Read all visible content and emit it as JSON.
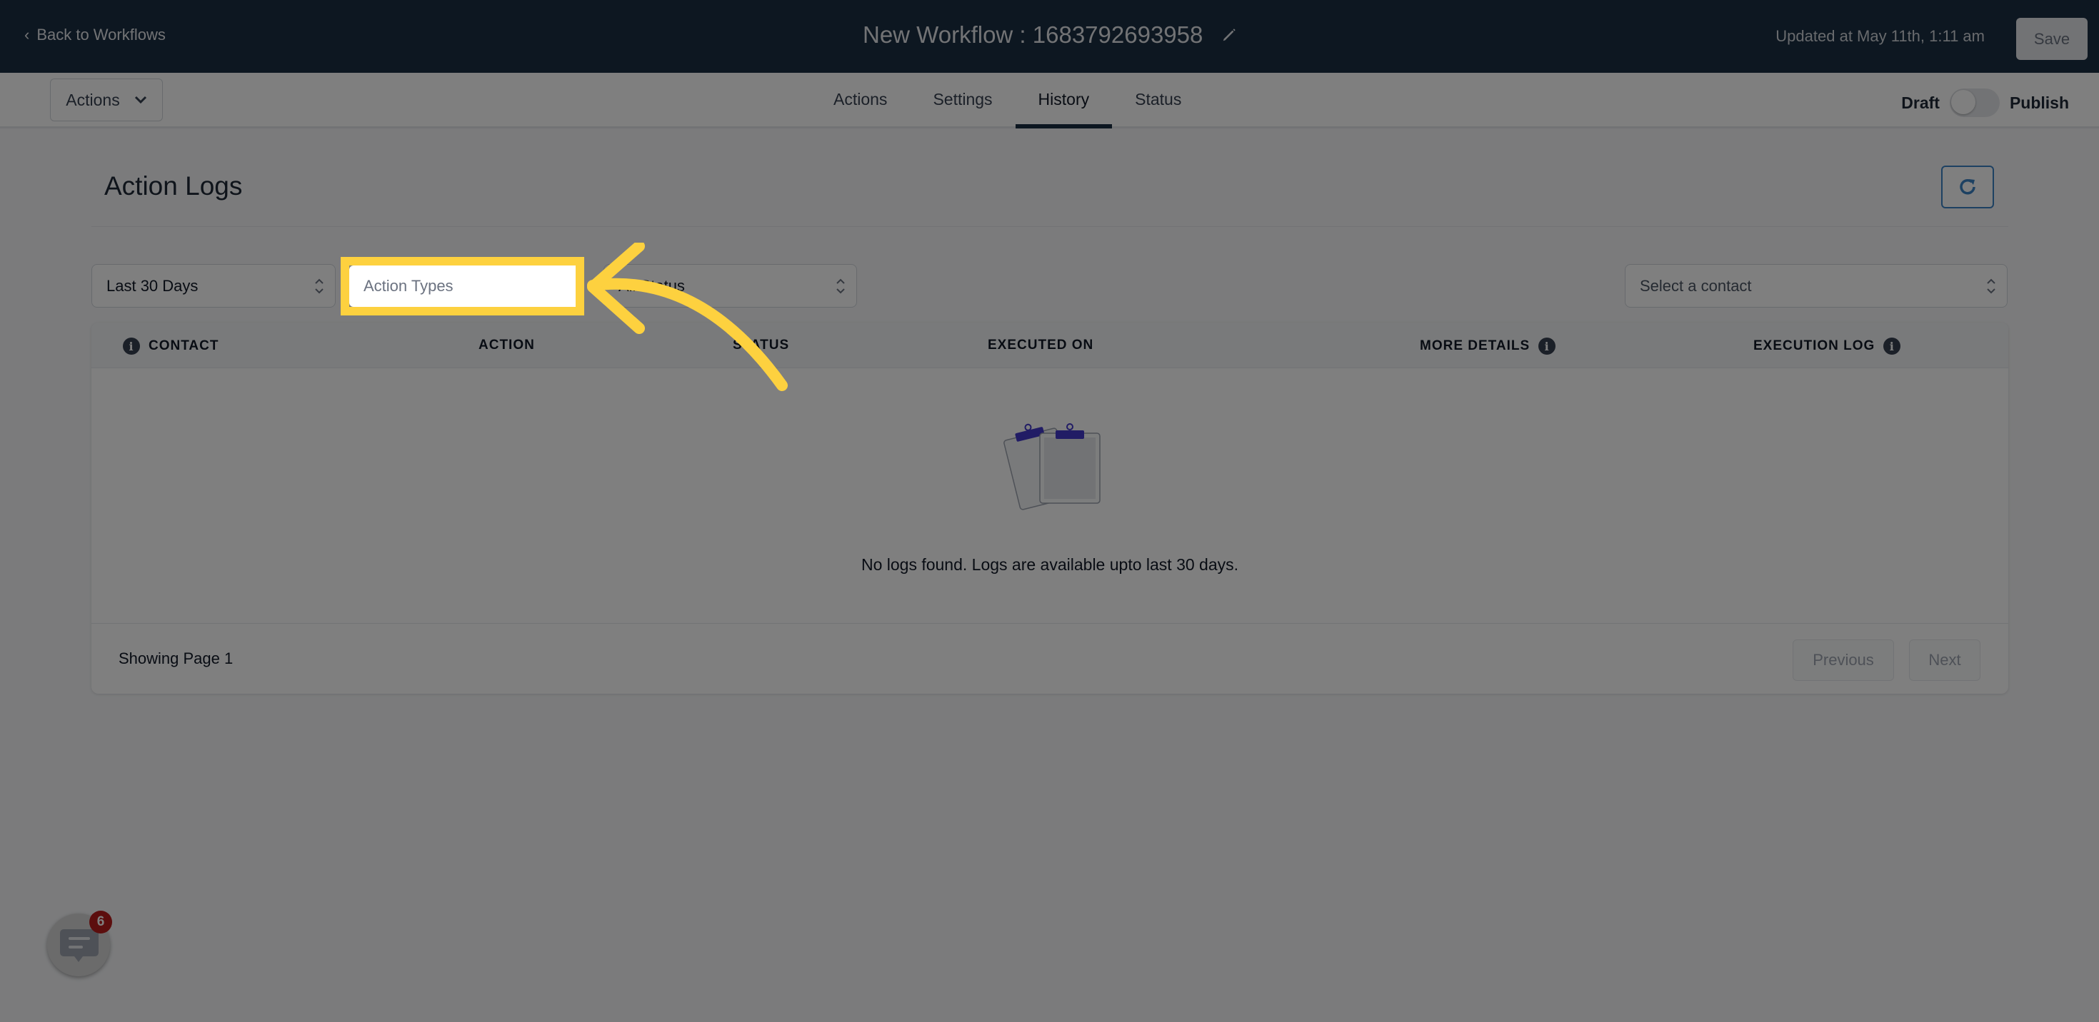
{
  "topbar": {
    "back_label": "Back to Workflows",
    "workflow_title": "New Workflow : 1683792693958",
    "updated_text": "Updated at May 11th, 1:11 am",
    "save_label": "Save"
  },
  "tabbar": {
    "actions_dropdown_label": "Actions",
    "tabs": [
      {
        "label": "Actions",
        "active": false
      },
      {
        "label": "Settings",
        "active": false
      },
      {
        "label": "History",
        "active": true
      },
      {
        "label": "Status",
        "active": false
      }
    ],
    "draft_label": "Draft",
    "publish_label": "Publish",
    "published": false
  },
  "page": {
    "title": "Action Logs",
    "refresh_icon": "refresh-icon"
  },
  "filters": {
    "date_range": "Last 30 Days",
    "action_types_placeholder": "Action Types",
    "status": "All Status",
    "contact_placeholder": "Select a contact"
  },
  "table": {
    "columns": [
      {
        "label": "CONTACT",
        "info_icon": "left"
      },
      {
        "label": "ACTION"
      },
      {
        "label": "STATUS"
      },
      {
        "label": "EXECUTED ON"
      },
      {
        "label": "MORE DETAILS",
        "info_icon": "right"
      },
      {
        "label": "EXECUTION LOG",
        "info_icon": "right"
      }
    ],
    "rows": [],
    "empty_message": "No logs found. Logs are available upto last 30 days.",
    "empty_icon": "clipboard-icon"
  },
  "pagination": {
    "page_info": "Showing Page 1",
    "previous_label": "Previous",
    "next_label": "Next"
  },
  "chat_widget": {
    "icon": "chat-icon",
    "badge_count": "6"
  },
  "annotation": {
    "highlight_color": "#fdd13f",
    "target": "Action Types"
  },
  "colors": {
    "header_bg": "#1a2e42",
    "accent_blue": "#3b82c4",
    "badge_red": "#b91c1c",
    "clip_purple": "#4338ca"
  }
}
